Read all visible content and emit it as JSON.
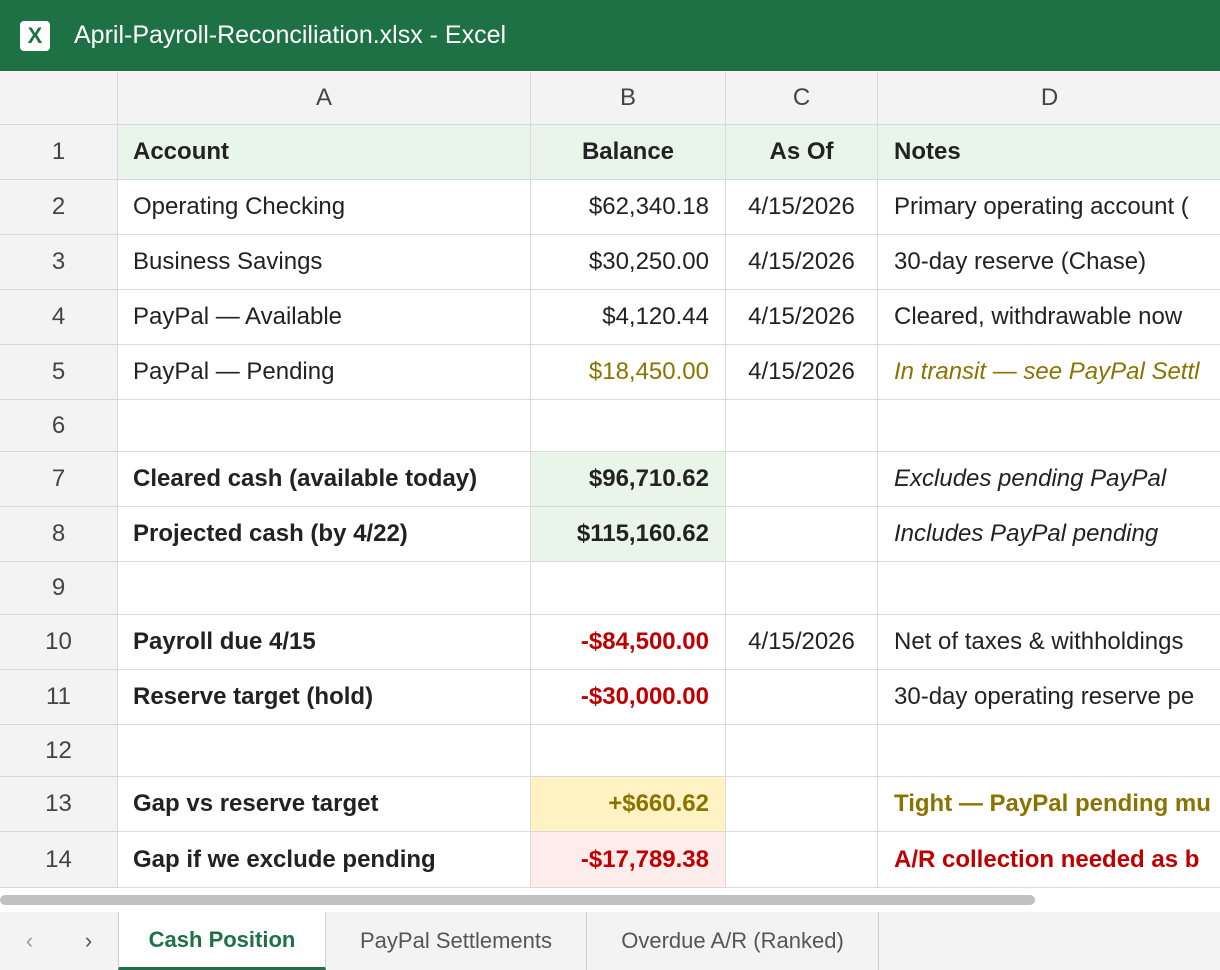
{
  "window": {
    "title": "April-Payroll-Reconciliation.xlsx - Excel",
    "app_icon_letter": "X"
  },
  "columns": [
    "A",
    "B",
    "C",
    "D"
  ],
  "rows": [
    {
      "num": "1",
      "a": "Account",
      "b": "Balance",
      "c": "As Of",
      "d": "Notes"
    },
    {
      "num": "2",
      "a": "Operating Checking",
      "b": "$62,340.18",
      "c": "4/15/2026",
      "d": "Primary operating account ("
    },
    {
      "num": "3",
      "a": "Business Savings",
      "b": "$30,250.00",
      "c": "4/15/2026",
      "d": "30-day reserve (Chase)"
    },
    {
      "num": "4",
      "a": "PayPal — Available",
      "b": "$4,120.44",
      "c": "4/15/2026",
      "d": "Cleared, withdrawable now"
    },
    {
      "num": "5",
      "a": "PayPal — Pending",
      "b": "$18,450.00",
      "c": "4/15/2026",
      "d": "In transit — see PayPal Settl"
    },
    {
      "num": "6",
      "a": "",
      "b": "",
      "c": "",
      "d": ""
    },
    {
      "num": "7",
      "a": "Cleared cash (available today)",
      "b": "$96,710.62",
      "c": "",
      "d": "Excludes pending PayPal"
    },
    {
      "num": "8",
      "a": "Projected cash (by 4/22)",
      "b": "$115,160.62",
      "c": "",
      "d": "Includes PayPal pending"
    },
    {
      "num": "9",
      "a": "",
      "b": "",
      "c": "",
      "d": ""
    },
    {
      "num": "10",
      "a": "Payroll due 4/15",
      "b": "-$84,500.00",
      "c": "4/15/2026",
      "d": "Net of taxes & withholdings"
    },
    {
      "num": "11",
      "a": "Reserve target (hold)",
      "b": "-$30,000.00",
      "c": "",
      "d": "30-day operating reserve pe"
    },
    {
      "num": "12",
      "a": "",
      "b": "",
      "c": "",
      "d": ""
    },
    {
      "num": "13",
      "a": "Gap vs reserve target",
      "b": "+$660.62",
      "c": "",
      "d": "Tight — PayPal pending mu"
    },
    {
      "num": "14",
      "a": "Gap if we exclude pending",
      "b": "-$17,789.38",
      "c": "",
      "d": "A/R collection needed as b"
    }
  ],
  "sheet_tabs": [
    {
      "label": "Cash Position",
      "active": true
    },
    {
      "label": "PayPal Settlements",
      "active": false
    },
    {
      "label": "Overdue A/R (Ranked)",
      "active": false
    }
  ],
  "nav": {
    "prev": "‹",
    "next": "›"
  },
  "colors": {
    "excel_green": "#1e7145",
    "olive_text": "#8a7300",
    "negative_red": "#c00000",
    "highlight_green": "#eaf5ea",
    "highlight_yellow": "#fff3c4",
    "highlight_pink": "#fdecec"
  }
}
